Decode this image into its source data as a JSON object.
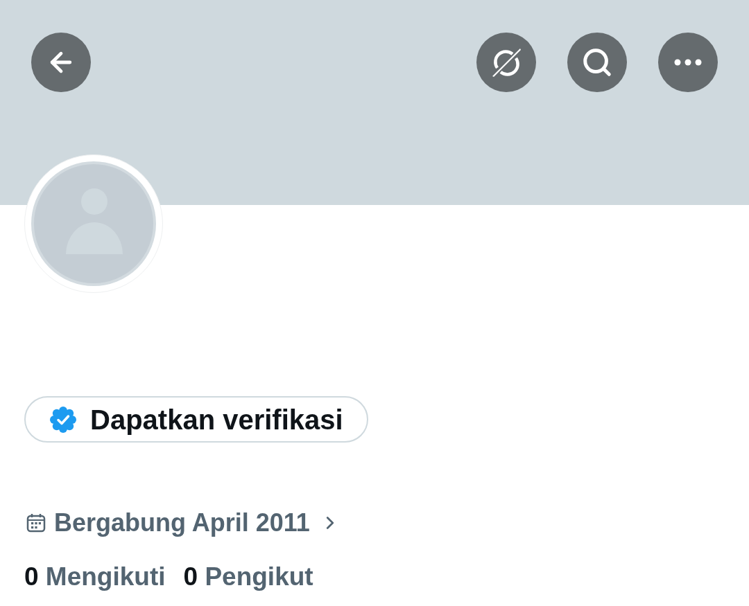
{
  "profile": {
    "verify_button": {
      "label": "Dapatkan verifikasi"
    },
    "joined": {
      "text": "Bergabung April 2011"
    },
    "stats": [
      {
        "count": "0",
        "label": "Mengikuti"
      },
      {
        "count": "0",
        "label": "Pengikut"
      }
    ]
  }
}
